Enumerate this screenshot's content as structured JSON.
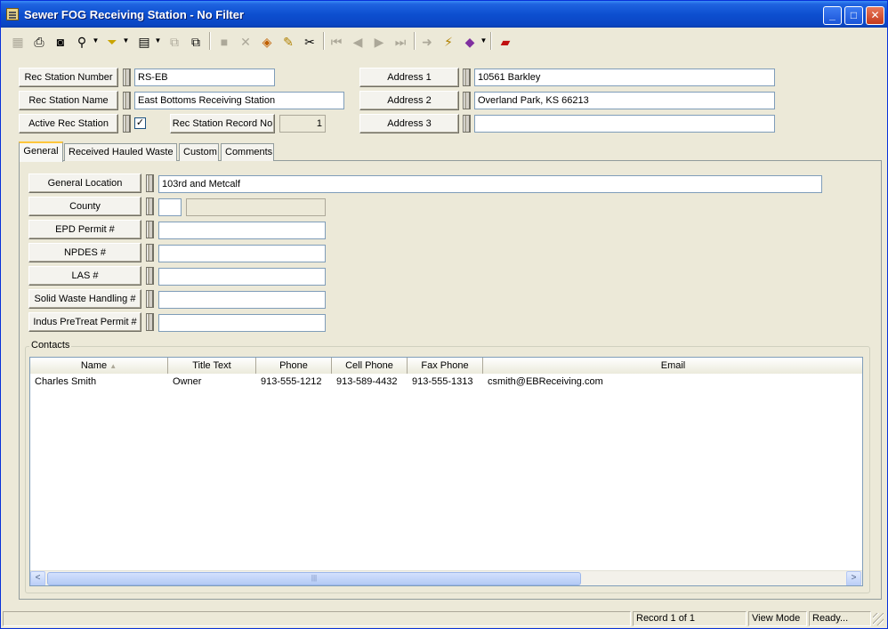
{
  "window": {
    "title": "Sewer FOG Receiving Station - No Filter",
    "buttons": {
      "minimize": "_",
      "maximize": "□",
      "close": "✕"
    }
  },
  "toolbar": {
    "icons": [
      "record-icon",
      "print-icon",
      "print-preview-icon",
      "find-icon",
      "filter-icon",
      "new-record-icon",
      "copy-icon",
      "paste-icon",
      "save-icon",
      "delete-icon",
      "undo-icon",
      "edit-pencil-icon",
      "cut-icon",
      "first-record-icon",
      "previous-record-icon",
      "next-record-icon",
      "last-record-icon",
      "goto-icon",
      "lightning-icon",
      "book-icon",
      "exit-icon"
    ]
  },
  "header": {
    "rec_station_number": {
      "label": "Rec Station Number",
      "value": "RS-EB"
    },
    "rec_station_name": {
      "label": "Rec Station Name",
      "value": "East Bottoms Receiving Station"
    },
    "active_rec_station": {
      "label": "Active Rec Station",
      "checked": true,
      "check_mark": "✓"
    },
    "rec_station_record_no": {
      "label": "Rec Station Record No",
      "value": "1"
    },
    "address1": {
      "label": "Address 1",
      "value": "10561 Barkley"
    },
    "address2": {
      "label": "Address 2",
      "value": "Overland Park, KS  66213"
    },
    "address3": {
      "label": "Address 3",
      "value": ""
    }
  },
  "tabs": [
    {
      "label": "General",
      "active": true
    },
    {
      "label": "Received Hauled Waste",
      "active": false
    },
    {
      "label": "Custom",
      "active": false
    },
    {
      "label": "Comments",
      "active": false
    }
  ],
  "general": {
    "general_location": {
      "label": "General Location",
      "value": "103rd and Metcalf"
    },
    "county": {
      "label": "County",
      "code": "",
      "name": ""
    },
    "epd_permit": {
      "label": "EPD Permit #",
      "value": ""
    },
    "npdes": {
      "label": "NPDES #",
      "value": ""
    },
    "las": {
      "label": "LAS #",
      "value": ""
    },
    "solid_waste": {
      "label": "Solid Waste Handling #",
      "value": ""
    },
    "indus_pretreat": {
      "label": "Indus PreTreat Permit #",
      "value": ""
    }
  },
  "contacts": {
    "label": "Contacts",
    "columns": [
      "Name",
      "Title Text",
      "Phone",
      "Cell Phone",
      "Fax Phone",
      "Email"
    ],
    "sort_indicator": "▲",
    "rows": [
      [
        "Charles Smith",
        "Owner",
        "913-555-1212",
        "913-589-4432",
        "913-555-1313",
        "csmith@EBReceiving.com"
      ]
    ],
    "scroll_left": "<",
    "scroll_right": ">",
    "thumb_grip": "|||"
  },
  "status": {
    "record": "Record 1 of 1",
    "mode": "View Mode",
    "state": "Ready..."
  }
}
